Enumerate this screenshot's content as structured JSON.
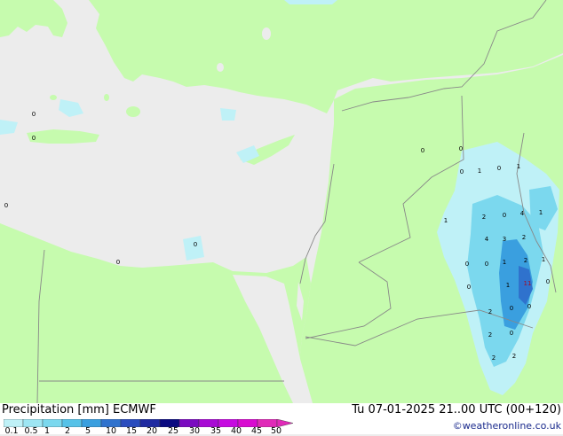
{
  "legend": {
    "title": "Precipitation [mm]",
    "model": "ECMWF",
    "ticks": [
      "0.1",
      "0.5",
      "1",
      "2",
      "5",
      "10",
      "15",
      "20",
      "25",
      "30",
      "35",
      "40",
      "45",
      "50"
    ],
    "colors": [
      "#bff1f7",
      "#9ee6f3",
      "#7bd8ee",
      "#56c2e8",
      "#3a9fdf",
      "#2f72cd",
      "#2a4cbd",
      "#1f2aa0",
      "#0a0a80",
      "#7a0ac0",
      "#a80ad4",
      "#c60ae0",
      "#d80ad0",
      "#e02ab8"
    ],
    "colors_meaning": "light cyan to blue to purple to magenta"
  },
  "valid_time": "Tu 07-01-2025 21..00 UTC (00+120)",
  "credit": "©weatheronline.co.uk",
  "map": {
    "land_color": "#c6fbae",
    "sea_color": "#ececec",
    "border_color": "#888888",
    "precip_labels": [
      {
        "value": "0",
        "lon": 0,
        "lat": 0
      },
      "0",
      "0",
      "0",
      "0",
      "0",
      "0",
      "0",
      "1",
      "0",
      "1",
      "2",
      "0",
      "4",
      "1",
      "1",
      "4",
      "3",
      "2",
      "0",
      "0",
      "1",
      "2",
      "1",
      "0",
      "1",
      "11",
      "0",
      "2",
      "0",
      "0",
      "2",
      "0",
      "2",
      "2"
    ]
  }
}
